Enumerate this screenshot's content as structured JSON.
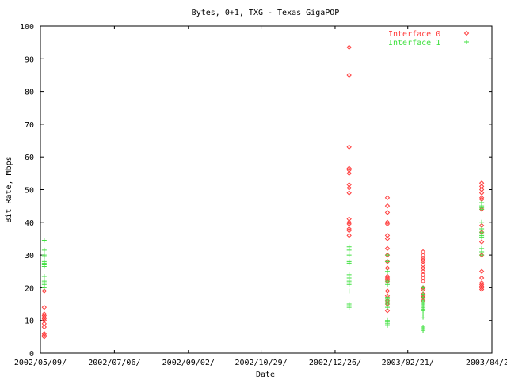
{
  "chart_data": {
    "type": "scatter",
    "title": "Bytes, 0+1, TXG - Texas GigaPOP",
    "xlabel": "Date",
    "ylabel": "Bit Rate, Mbps",
    "ylim": [
      0,
      100
    ],
    "xlim": [
      "2002/05/09",
      "2003/04/28"
    ],
    "yticks": [
      "0",
      "10",
      "20",
      "30",
      "40",
      "50",
      "60",
      "70",
      "80",
      "90",
      "100"
    ],
    "xticks": [
      {
        "label": "2002/05/09/",
        "date": "2002/05/09"
      },
      {
        "label": "2002/07/06/",
        "date": "2002/07/06"
      },
      {
        "label": "2002/09/02/",
        "date": "2002/09/02"
      },
      {
        "label": "2002/10/29/",
        "date": "2002/10/29"
      },
      {
        "label": "2002/12/26/",
        "date": "2002/12/26"
      },
      {
        "label": "2003/02/21/",
        "date": "2003/02/21"
      },
      {
        "label": "2003/04/28/",
        "date": "2003/04/28"
      }
    ],
    "legend_position": "top-right",
    "series": [
      {
        "name": "Interface 0",
        "color": "#ff4040",
        "marker": "diamond",
        "groups": [
          {
            "date": "2002/05/12",
            "values": [
              5,
              5.5,
              6,
              8,
              9,
              10,
              10.5,
              11,
              11.5,
              12,
              14,
              19
            ]
          },
          {
            "date": "2003/01/06",
            "values": [
              93.5,
              85,
              63,
              56.5,
              56,
              55,
              51.5,
              50.5,
              49,
              41,
              40,
              39.5,
              38,
              37.5,
              36
            ]
          },
          {
            "date": "2003/02/05",
            "values": [
              47.5,
              45,
              43,
              40,
              39.5,
              36,
              35,
              32,
              30,
              28,
              26,
              23.5,
              23,
              22.5,
              22,
              19,
              17.5,
              16,
              15,
              13
            ]
          },
          {
            "date": "2003/03/05",
            "values": [
              31,
              30,
              29,
              28.5,
              28,
              27,
              26,
              25,
              24,
              23,
              22,
              20,
              19.5,
              18,
              17.5,
              17,
              16
            ]
          },
          {
            "date": "2003/04/20",
            "values": [
              52,
              51,
              50,
              49,
              47.5,
              47,
              44,
              39,
              37,
              34,
              30,
              25,
              23,
              21.5,
              21,
              20.5,
              20,
              19.5
            ]
          }
        ]
      },
      {
        "name": "Interface 1",
        "color": "#40e040",
        "marker": "plus",
        "groups": [
          {
            "date": "2002/05/12",
            "values": [
              34.5,
              31.5,
              30,
              29.5,
              28,
              27.5,
              27,
              26.5,
              23.5,
              22,
              21.5,
              21,
              20
            ]
          },
          {
            "date": "2003/01/06",
            "values": [
              32.5,
              31.5,
              30,
              28,
              27.5,
              24,
              23,
              22,
              21.5,
              21,
              19,
              15,
              14.5,
              14
            ]
          },
          {
            "date": "2003/02/05",
            "values": [
              30,
              28,
              25,
              22,
              21.5,
              21,
              17,
              16.5,
              16,
              15.5,
              15,
              14,
              10,
              9.5,
              9,
              8.5
            ]
          },
          {
            "date": "2003/03/05",
            "values": [
              20,
              18,
              17,
              16,
              15.5,
              15,
              14.5,
              14,
              13.5,
              13,
              12,
              11,
              8,
              7.5,
              7
            ]
          },
          {
            "date": "2003/04/20",
            "values": [
              46,
              45,
              44.5,
              44,
              40,
              38,
              37,
              36.5,
              36,
              35.5,
              32,
              31,
              30
            ]
          }
        ]
      }
    ]
  }
}
